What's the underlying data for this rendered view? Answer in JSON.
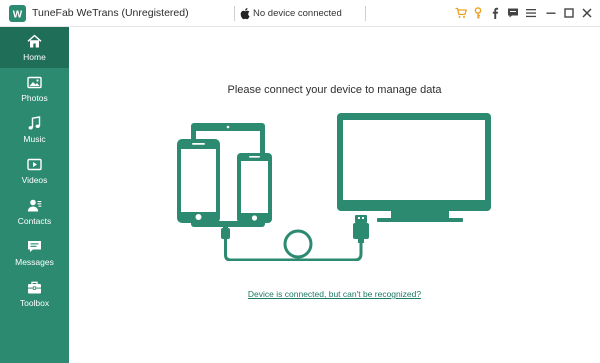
{
  "app": {
    "title": "TuneFab WeTrans (Unregistered)",
    "logo_letter": "W"
  },
  "device": {
    "status": "No device connected"
  },
  "titlebar_icons": [
    "cart-icon",
    "key-icon",
    "facebook-icon",
    "chat-icon",
    "menu-icon",
    "minimize-icon",
    "maximize-icon",
    "close-icon"
  ],
  "sidebar": {
    "items": [
      {
        "label": "Home",
        "icon": "home-icon",
        "active": true
      },
      {
        "label": "Photos",
        "icon": "photos-icon",
        "active": false
      },
      {
        "label": "Music",
        "icon": "music-icon",
        "active": false
      },
      {
        "label": "Videos",
        "icon": "videos-icon",
        "active": false
      },
      {
        "label": "Contacts",
        "icon": "contacts-icon",
        "active": false
      },
      {
        "label": "Messages",
        "icon": "messages-icon",
        "active": false
      },
      {
        "label": "Toolbox",
        "icon": "toolbox-icon",
        "active": false
      }
    ]
  },
  "main": {
    "headline": "Please connect your device to manage data",
    "help_link": "Device is connected, but can't be recognized?"
  },
  "colors": {
    "brand": "#2b8a6f",
    "brand_active": "#1f6e57",
    "accent_orange": "#f0a020"
  }
}
